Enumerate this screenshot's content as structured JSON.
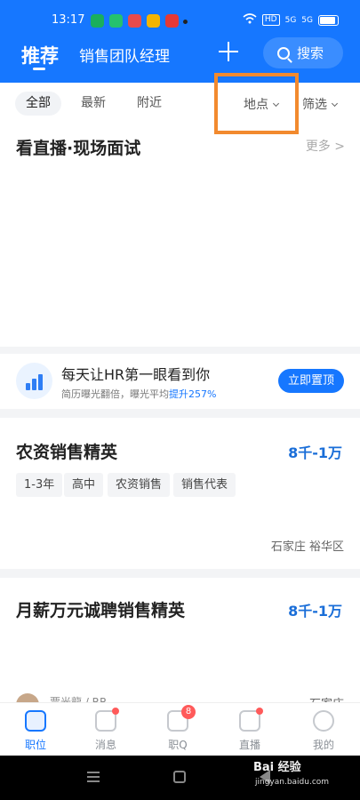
{
  "status_bar": {
    "time": "13:17",
    "right_labels": [
      "HD",
      "5G",
      "5G"
    ]
  },
  "header": {
    "active_tab": "推荐",
    "tab2": "销售团队经理",
    "search_label": "搜索"
  },
  "filter": {
    "chips": [
      "全部",
      "最新",
      "附近"
    ],
    "location": "地点",
    "filter": "筛选"
  },
  "live_section": {
    "title": "看直播·现场面试",
    "more": "更多 >"
  },
  "promo": {
    "title": "每天让HR第一眼看到你",
    "sub_prefix": "简历曝光翻倍，曝光平均",
    "sub_highlight": "提升257%",
    "button": "立即置顶"
  },
  "jobs": [
    {
      "title": "农资销售精英",
      "salary": "8千-1万",
      "tags": [
        "1-3年",
        "高中",
        "农资销售",
        "销售代表"
      ],
      "location": "石家庄 裕华区"
    },
    {
      "title": "月薪万元诚聘销售精英",
      "salary": "8千-1万",
      "recruiter": "贾光龍 / RR",
      "location": "石家庄"
    }
  ],
  "bottom_nav": {
    "items": [
      "职位",
      "消息",
      "职Q",
      "直播",
      "我的"
    ],
    "badge_count": "8"
  },
  "watermark": {
    "main": "Bai 经验",
    "sub": "jingyan.baidu.com"
  },
  "colors": {
    "primary": "#1677ff",
    "salary": "#1a6ed8",
    "highlight_box": "#f28a2e",
    "badge": "#ff5a5a"
  }
}
